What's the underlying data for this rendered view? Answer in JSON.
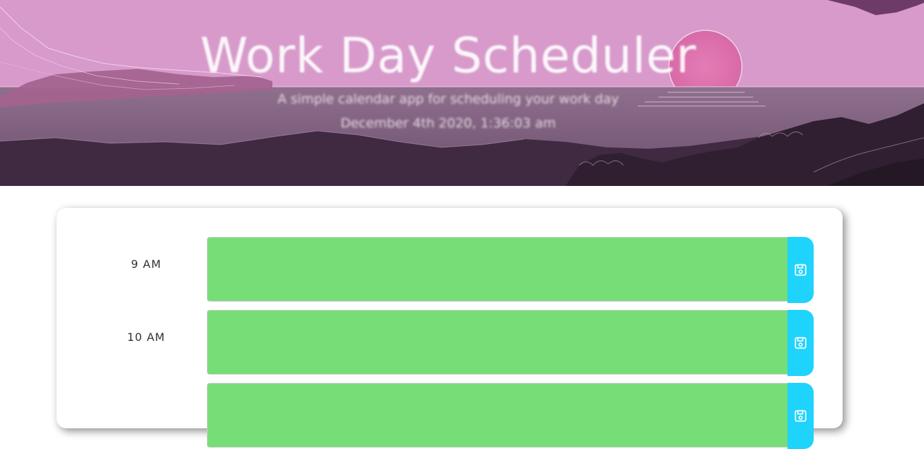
{
  "header": {
    "title": "Work Day Scheduler",
    "subtitle": "A simple calendar app for scheduling your work day",
    "datetime": "December 4th 2020, 1:36:03 am"
  },
  "colors": {
    "present": "#77dd77",
    "save_button": "#1ed3fc",
    "header_sky": "#d79acb"
  },
  "schedule": {
    "rows": [
      {
        "hour": "9  AM",
        "description": "",
        "save_icon": "floppy-disk-icon"
      },
      {
        "hour": "10  AM",
        "description": "",
        "save_icon": "floppy-disk-icon"
      },
      {
        "hour": "",
        "description": "",
        "save_icon": "floppy-disk-icon"
      }
    ]
  }
}
